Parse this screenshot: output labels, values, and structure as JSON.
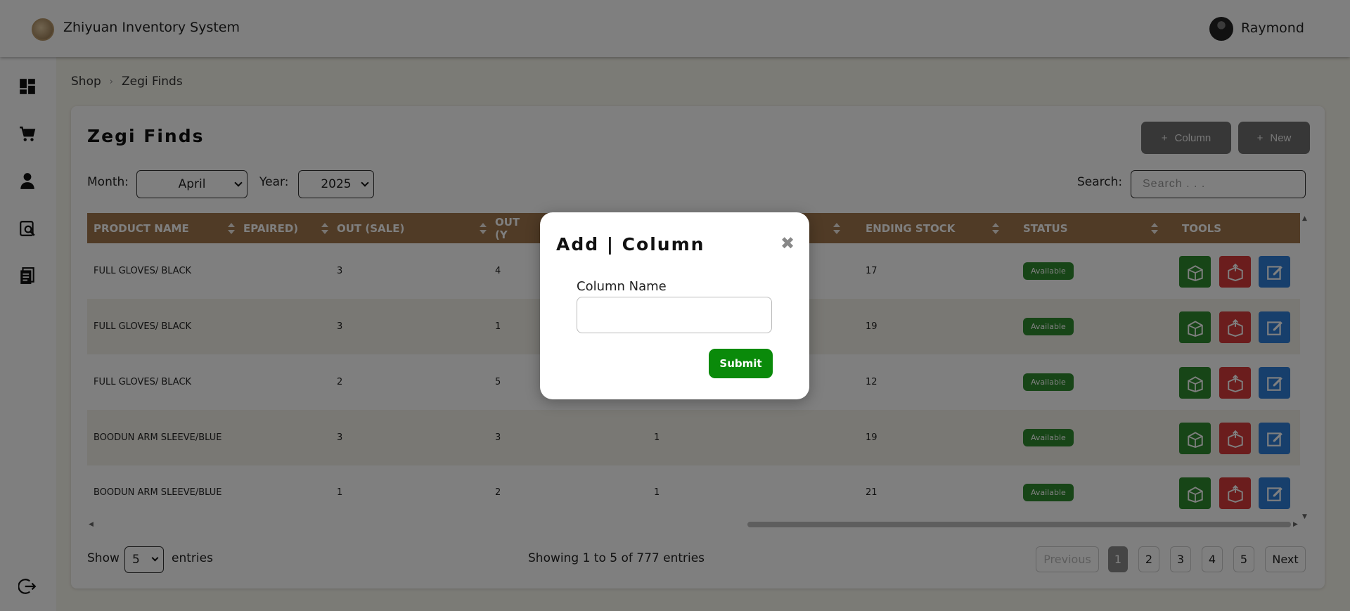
{
  "app": {
    "title": "Zhiyuan Inventory System",
    "user_name": "Raymond"
  },
  "sidebar": {
    "icons": [
      "dashboard-icon",
      "cart-icon",
      "user-icon",
      "search-document-icon",
      "report-icon",
      "logout-icon"
    ]
  },
  "breadcrumb": {
    "items": [
      "Shop",
      "Zegi Finds"
    ]
  },
  "page": {
    "title": "Zegi Finds",
    "column_button": "Column",
    "new_button": "New"
  },
  "filters": {
    "month_label": "Month:",
    "month_value": "April",
    "year_label": "Year:",
    "year_value": "2025",
    "search_label": "Search:",
    "search_placeholder": "Search . . ."
  },
  "table": {
    "headers": [
      "PRODUCT NAME",
      "EPAIRED)",
      "OUT (SALE)",
      "OUT (Y",
      "",
      "ENDING STOCK",
      "STATUS",
      "TOOLS"
    ],
    "rows": [
      {
        "product": "FULL GLOVES/ BLACK",
        "repaired": "",
        "out_sale": "3",
        "out_y": "4",
        "col5": "",
        "ending": "17",
        "status": "Available"
      },
      {
        "product": "FULL GLOVES/ BLACK",
        "repaired": "",
        "out_sale": "3",
        "out_y": "1",
        "col5": "",
        "ending": "19",
        "status": "Available"
      },
      {
        "product": "FULL GLOVES/ BLACK",
        "repaired": "",
        "out_sale": "2",
        "out_y": "5",
        "col5": "",
        "ending": "12",
        "status": "Available"
      },
      {
        "product": "BOODUN ARM SLEEVE/BLUE",
        "repaired": "",
        "out_sale": "3",
        "out_y": "3",
        "col5": "1",
        "ending": "19",
        "status": "Available"
      },
      {
        "product": "BOODUN ARM SLEEVE/BLUE",
        "repaired": "",
        "out_sale": "1",
        "out_y": "2",
        "col5": "1",
        "ending": "21",
        "status": "Available"
      }
    ]
  },
  "footer": {
    "show_label": "Show",
    "entries_value": "5",
    "entries_label": "entries",
    "summary": "Showing 1 to 5 of 777 entries",
    "pagination": {
      "previous": "Previous",
      "pages": [
        "1",
        "2",
        "3",
        "4",
        "5"
      ],
      "next": "Next"
    }
  },
  "modal": {
    "title": "Add | Column",
    "close_symbol": "✖",
    "field_label": "Column Name",
    "field_value": "",
    "submit_label": "Submit"
  },
  "colors": {
    "table_header": "#a0774c",
    "status_badge": "#2f8a2f",
    "tool_green": "#2f8a2f",
    "tool_red": "#d63a3a",
    "tool_blue": "#2f7fd9",
    "submit": "#0a8a0a"
  }
}
